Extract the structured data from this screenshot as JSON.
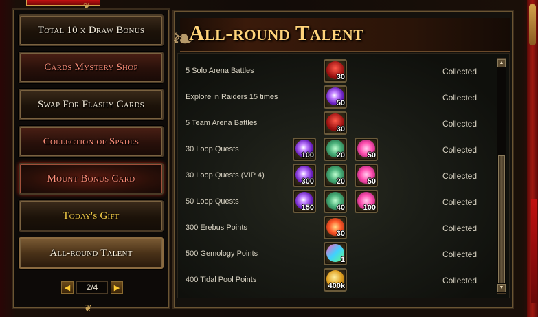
{
  "menu": {
    "items": [
      {
        "label": "Total 10 x Draw Bonus",
        "style": "normal"
      },
      {
        "label": "Cards Mystery Shop",
        "style": "red"
      },
      {
        "label": "Swap For Flashy Cards",
        "style": "normal"
      },
      {
        "label": "Collection of Spades",
        "style": "red"
      },
      {
        "label": "Mount Bonus Card",
        "style": "red2"
      },
      {
        "label": "Today's Gift",
        "style": "gold"
      },
      {
        "label": "All-round Talent",
        "style": "active"
      }
    ],
    "pager": {
      "prev_icon": "left-arrow-icon",
      "next_icon": "right-arrow-icon",
      "page_text": "2/4"
    }
  },
  "panel": {
    "title": "All-round Talent"
  },
  "rows": [
    {
      "label": "5 Solo Arena Battles",
      "status": "Collected",
      "rewards": [
        {
          "icon": "red-shield-icon",
          "qty": "30"
        }
      ]
    },
    {
      "label": "Explore in Raiders 15 times",
      "status": "Collected",
      "rewards": [
        {
          "icon": "purple-orb-icon",
          "qty": "50"
        }
      ]
    },
    {
      "label": "5 Team Arena Battles",
      "status": "Collected",
      "rewards": [
        {
          "icon": "red-shield-icon",
          "qty": "30"
        }
      ]
    },
    {
      "label": "30 Loop Quests",
      "status": "Collected",
      "rewards": [
        {
          "icon": "purple-orb-icon",
          "qty": "100"
        },
        {
          "icon": "green-crystal-icon",
          "qty": "20"
        },
        {
          "icon": "pink-star-icon",
          "qty": "50"
        }
      ]
    },
    {
      "label": "30 Loop Quests (VIP 4)",
      "status": "Collected",
      "rewards": [
        {
          "icon": "purple-orb-icon",
          "qty": "300"
        },
        {
          "icon": "green-crystal-icon",
          "qty": "20"
        },
        {
          "icon": "pink-star-icon",
          "qty": "50"
        }
      ]
    },
    {
      "label": "50 Loop Quests",
      "status": "Collected",
      "rewards": [
        {
          "icon": "purple-orb-icon",
          "qty": "150"
        },
        {
          "icon": "green-crystal-icon",
          "qty": "40"
        },
        {
          "icon": "pink-star-icon",
          "qty": "100"
        }
      ]
    },
    {
      "label": "300 Erebus Points",
      "status": "Collected",
      "rewards": [
        {
          "icon": "fire-crystal-icon",
          "qty": "30"
        }
      ]
    },
    {
      "label": "500 Gemology Points",
      "status": "Collected",
      "rewards": [
        {
          "icon": "gem-icon",
          "qty": "1"
        }
      ]
    },
    {
      "label": "400 Tidal Pool Points",
      "status": "Collected",
      "rewards": [
        {
          "icon": "gold-coin-icon",
          "qty": "400k"
        }
      ]
    }
  ],
  "scrollbar": {
    "up_icon": "scroll-up-icon",
    "down_icon": "scroll-down-icon"
  }
}
